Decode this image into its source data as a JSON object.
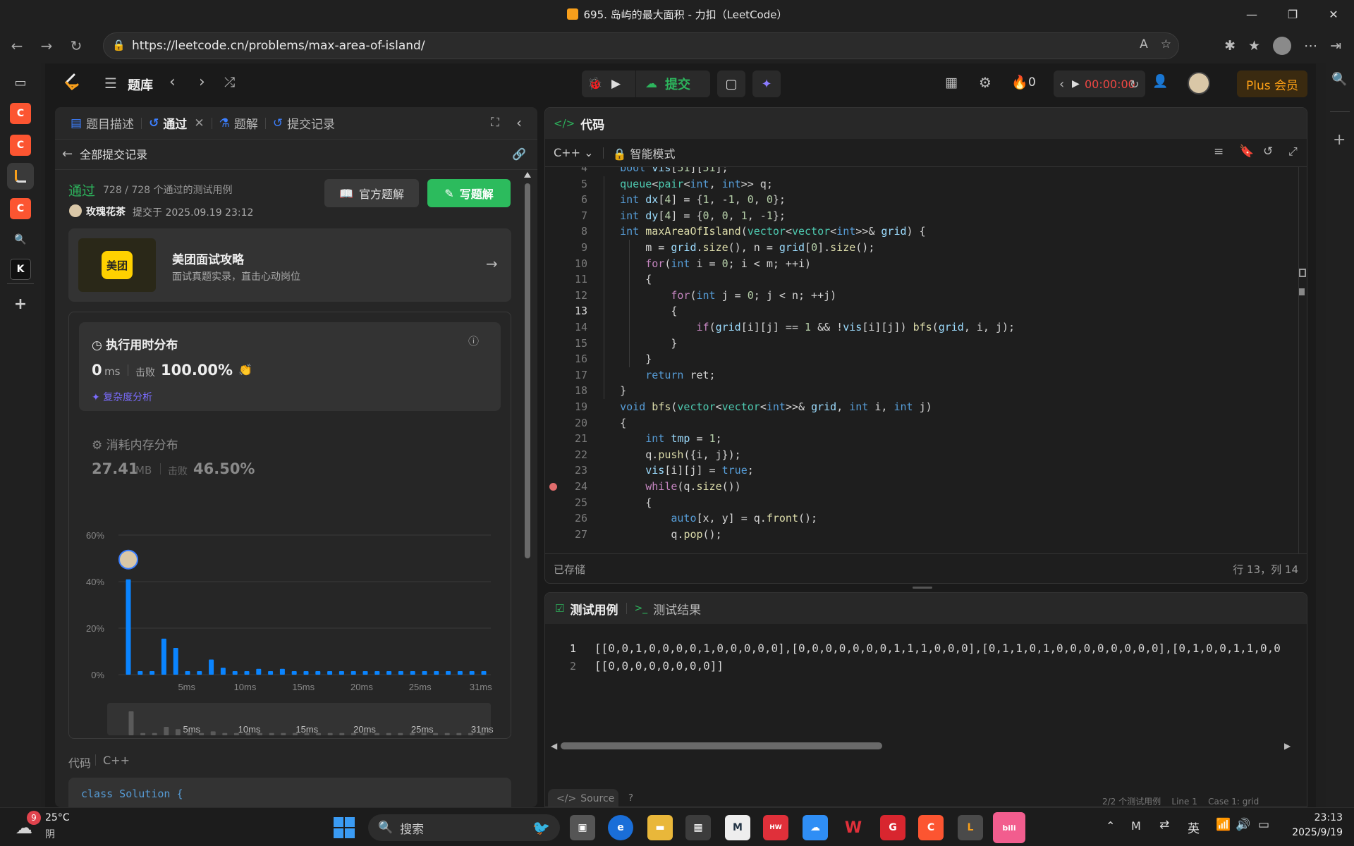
{
  "window": {
    "title": "695. 岛屿的最大面积 - 力扣（LeetCode）",
    "controls": [
      "—",
      "❐",
      "✕"
    ]
  },
  "browser": {
    "url": "https://leetcode.cn/problems/max-area-of-island/"
  },
  "nav": {
    "problem_bank": "题库",
    "submit": "提交",
    "streak_count": "0",
    "timer": "00:00:00",
    "plus": "Plus 会员"
  },
  "left_tabs": [
    {
      "label": "题目描述"
    },
    {
      "label": "通过"
    },
    {
      "label": "题解"
    },
    {
      "label": "提交记录"
    }
  ],
  "submission": {
    "back_label": "全部提交记录",
    "status": "通过",
    "testcases": "728 / 728 个通过的测试用例",
    "user": "玫瑰花茶",
    "submitted_at": "提交于 2025.09.19 23:12",
    "official_solution": "官方题解",
    "write_solution": "写题解"
  },
  "ad": {
    "logo": "美团",
    "title": "美团面试攻略",
    "subtitle": "面试真题实录，直击心动岗位"
  },
  "runtime": {
    "title": "执行用时分布",
    "value": "0",
    "unit": "ms",
    "beat_label": "击败",
    "beat": "100.00%",
    "complexity": "复杂度分析"
  },
  "memory": {
    "title": "消耗内存分布",
    "value": "27.41",
    "unit": "MB",
    "beat_label": "击败",
    "beat": "46.50%"
  },
  "chart_data": {
    "type": "bar",
    "y_ticks": [
      "60%",
      "40%",
      "20%",
      "0%"
    ],
    "x_ticks": [
      "5ms",
      "10ms",
      "15ms",
      "20ms",
      "25ms",
      "31ms"
    ],
    "ylim": [
      0,
      60
    ],
    "values": [
      41,
      1.5,
      1.5,
      15.5,
      11.5,
      1.5,
      1.5,
      6.5,
      3,
      1.5,
      1.5,
      2.5,
      1.5,
      2.5,
      1.5,
      1.5,
      1.5,
      1.5,
      1.5,
      1.5,
      1.5,
      1.5,
      1.5,
      1.5,
      1.5,
      1.5,
      1.5,
      1.5,
      1.5,
      1.5,
      1.5
    ],
    "mini_values": [
      85,
      8,
      8,
      30,
      22,
      8,
      8,
      14,
      8,
      8,
      8,
      8,
      8,
      8,
      8,
      8,
      8,
      8,
      8,
      8,
      8,
      8,
      8,
      8,
      8,
      8,
      8,
      8,
      8,
      8,
      8
    ],
    "highlight_index": 0,
    "bar_color": "#0a84ff"
  },
  "code_section": {
    "label": "代码",
    "lang": "C++",
    "preview": "class Solution {"
  },
  "editor": {
    "title": "代码",
    "lang": "C++",
    "mode": "智能模式",
    "saved": "已存储",
    "cursor": "行 13，列 14",
    "lines": [
      {
        "n": "4",
        "text": "    bool vis[51][51];"
      },
      {
        "n": "5",
        "text": "    queue<pair<int, int>> q;"
      },
      {
        "n": "6",
        "text": "    int dx[4] = {1, -1, 0, 0};"
      },
      {
        "n": "7",
        "text": "    int dy[4] = {0, 0, 1, -1};"
      },
      {
        "n": "8",
        "text": "    int maxAreaOfIsland(vector<vector<int>>& grid) {"
      },
      {
        "n": "9",
        "text": "        m = grid.size(), n = grid[0].size();"
      },
      {
        "n": "10",
        "text": "        for(int i = 0; i < m; ++i)"
      },
      {
        "n": "11",
        "text": "        {"
      },
      {
        "n": "12",
        "text": "            for(int j = 0; j < n; ++j)"
      },
      {
        "n": "13",
        "text": "            {"
      },
      {
        "n": "14",
        "text": "                if(grid[i][j] == 1 && !vis[i][j]) bfs(grid, i, j);"
      },
      {
        "n": "15",
        "text": "            }"
      },
      {
        "n": "16",
        "text": "        }"
      },
      {
        "n": "17",
        "text": "        return ret;"
      },
      {
        "n": "18",
        "text": "    }"
      },
      {
        "n": "19",
        "text": "    void bfs(vector<vector<int>>& grid, int i, int j)"
      },
      {
        "n": "20",
        "text": "    {"
      },
      {
        "n": "21",
        "text": "        int tmp = 1;"
      },
      {
        "n": "22",
        "text": "        q.push({i, j});"
      },
      {
        "n": "23",
        "text": "        vis[i][j] = true;"
      },
      {
        "n": "24",
        "text": "        while(q.size())"
      },
      {
        "n": "25",
        "text": "        {"
      },
      {
        "n": "26",
        "text": "            auto[x, y] = q.front();"
      },
      {
        "n": "27",
        "text": "            q.pop();"
      }
    ],
    "breakpoint_line": "24",
    "active_line": "13"
  },
  "tests": {
    "tab_cases": "测试用例",
    "tab_result": "测试结果",
    "lines": [
      {
        "n": "1",
        "text": "[[0,0,1,0,0,0,0,1,0,0,0,0,0],[0,0,0,0,0,0,0,1,1,1,0,0,0],[0,1,1,0,1,0,0,0,0,0,0,0,0],[0,1,0,0,1,1,0,0"
      },
      {
        "n": "2",
        "text": "[[0,0,0,0,0,0,0,0]]"
      }
    ],
    "footer_left": "Source",
    "footer_right": "2/2 个测试用例    Line 1    Case 1: grid"
  },
  "taskbar": {
    "temp": "25°C",
    "weather": "阴",
    "badge": "9",
    "search": "搜索",
    "ime": "英",
    "time": "23:13",
    "date": "2025/9/19"
  }
}
